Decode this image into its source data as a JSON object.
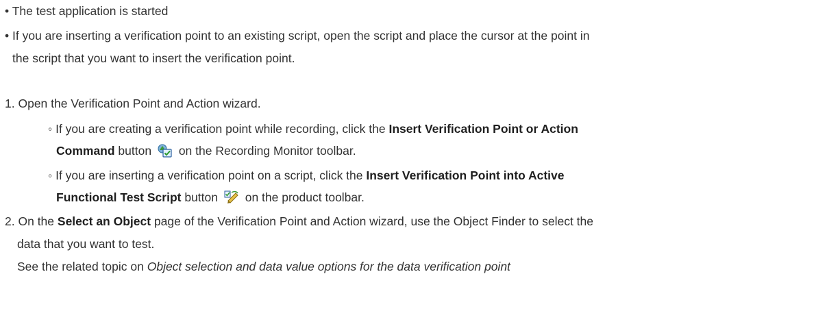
{
  "prereqs": [
    {
      "bullet": "•",
      "text": "The test application is started"
    },
    {
      "bullet": "•",
      "text_a": "If you are inserting a verification point to an existing script, open the script and place the cursor at the point in",
      "text_b": "the script that you want to insert the verification point."
    }
  ],
  "steps": {
    "s1": {
      "num": "1.",
      "text": "Open the Verification Point and Action wizard.",
      "subs": [
        {
          "marker": "◦",
          "pre": "If you are creating a verification point while recording, click the ",
          "bold_a": "Insert Verification Point or Action",
          "bold_b": "Command",
          "mid": " button ",
          "icon": "insert-vp-action-icon",
          "post": " on the Recording Monitor toolbar."
        },
        {
          "marker": "◦",
          "pre": "If you are inserting a verification point on a script, click the ",
          "bold_a": "Insert Verification Point into Active",
          "bold_b": "Functional Test Script",
          "mid": " button ",
          "icon": "insert-vp-script-icon",
          "post": " on the product toolbar."
        }
      ]
    },
    "s2": {
      "num": "2.",
      "pre": "On the ",
      "bold": "Select an Object",
      "post": " page of the Verification Point and Action wizard, use the Object Finder to select the",
      "line2": "data that you want to test.",
      "see_pre": "See the related topic on ",
      "see_ital": "Object selection and data value options for the data verification point"
    }
  }
}
